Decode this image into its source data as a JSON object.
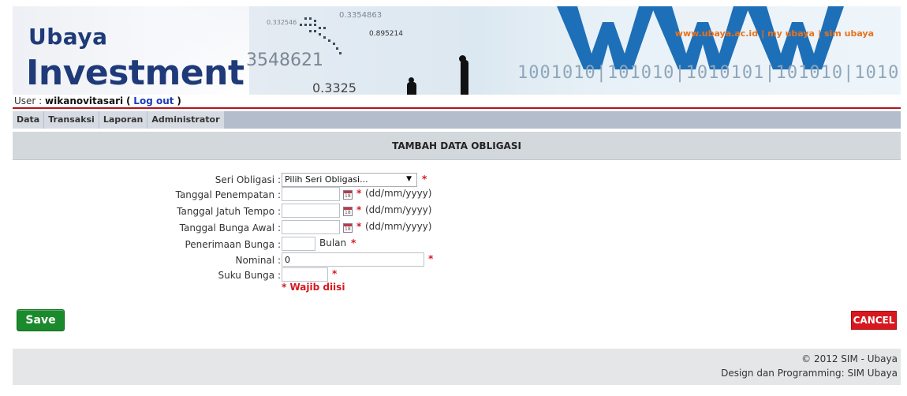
{
  "banner": {
    "brand_small": "Ubaya",
    "brand_big": "Investment",
    "deco_numbers": [
      "0.3354863",
      "0.332546",
      "0.895214",
      "3548621",
      "0.3325"
    ],
    "binary_text": "1001010|101010|1010101|101010|10101010",
    "links": [
      "www.ubaya.ac.id",
      "my ubaya",
      "sim ubaya"
    ],
    "link_separator": "|"
  },
  "user": {
    "prefix": "User :",
    "name": "wikanovitasari",
    "open_paren": "(",
    "logout_label": "Log out",
    "close_paren": ")"
  },
  "menu": {
    "items": [
      "Data",
      "Transaksi",
      "Laporan",
      "Administrator"
    ]
  },
  "title": "TAMBAH DATA OBLIGASI",
  "form": {
    "seri": {
      "label": "Seri Obligasi :",
      "value": "Pilih Seri Obligasi..."
    },
    "tgl_penempatan": {
      "label": "Tanggal Penempatan :",
      "value": "",
      "hint": "(dd/mm/yyyy)"
    },
    "tgl_jatuh_tempo": {
      "label": "Tanggal Jatuh Tempo :",
      "value": "",
      "hint": "(dd/mm/yyyy)"
    },
    "tgl_bunga_awal": {
      "label": "Tanggal Bunga Awal :",
      "value": "",
      "hint": "(dd/mm/yyyy)"
    },
    "penerimaan_bunga": {
      "label": "Penerimaan Bunga :",
      "value": "",
      "unit": "Bulan"
    },
    "nominal": {
      "label": "Nominal :",
      "value": "0"
    },
    "suku_bunga": {
      "label": "Suku Bunga :",
      "value": ""
    },
    "required_mark": "*",
    "required_note": "* Wajib diisi"
  },
  "buttons": {
    "save": "Save",
    "cancel": "CANCEL"
  },
  "footer": {
    "copyright": "© 2012 SIM - Ubaya",
    "credit": "Design dan Programming: SIM Ubaya"
  },
  "icons": {
    "calendar": "calendar-icon",
    "dropdown": "chevron-down-icon"
  },
  "colors": {
    "brand": "#1f3a78",
    "link_orange": "#e9721c",
    "accent_red": "#d6181f",
    "save_green": "#1b8a2c"
  }
}
